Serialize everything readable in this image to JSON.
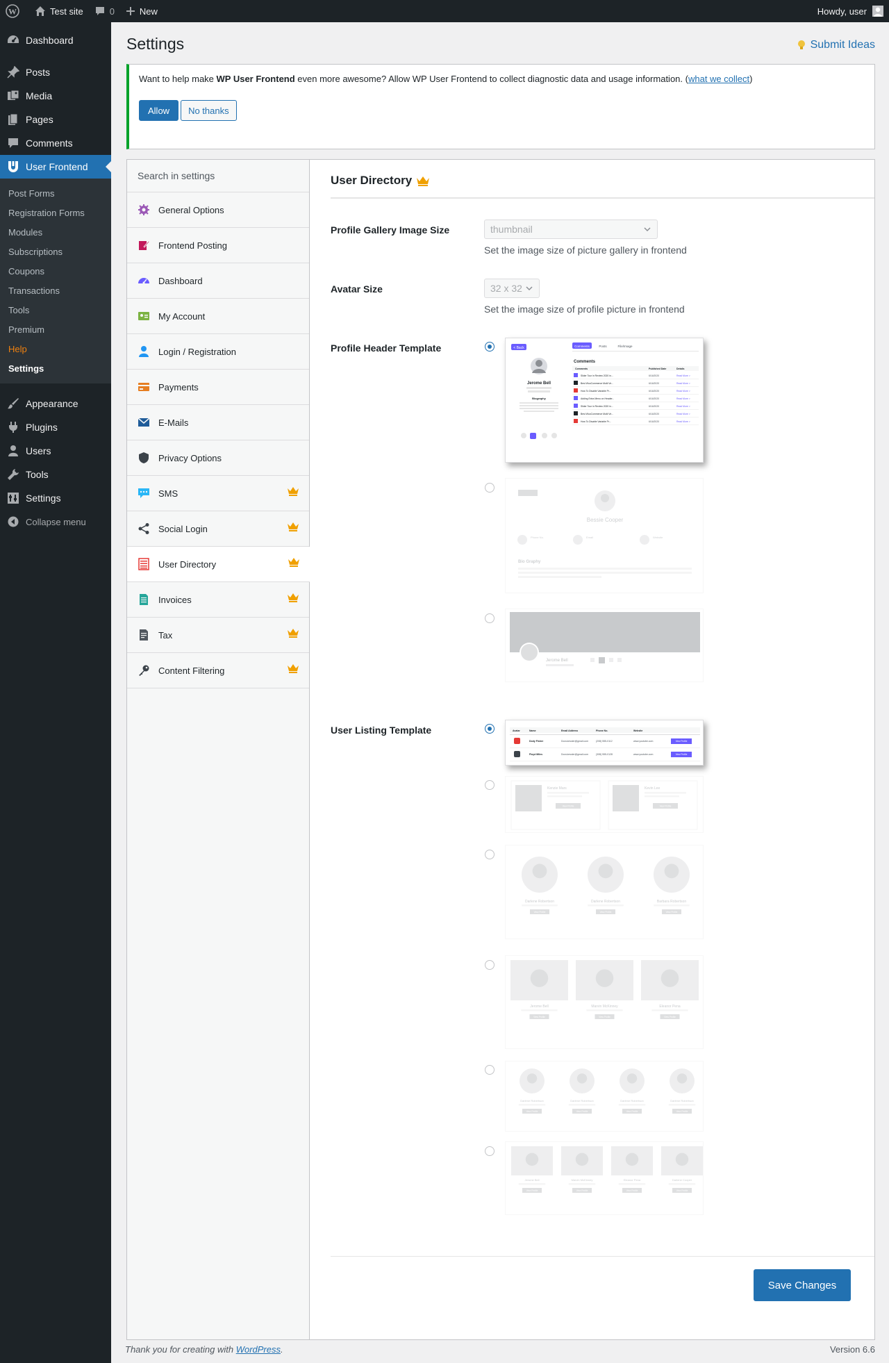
{
  "adminbar": {
    "site_name": "Test site",
    "comments_count": "0",
    "new_label": "New",
    "howdy": "Howdy, user"
  },
  "sidebar": {
    "top_items": [
      {
        "label": "Dashboard",
        "icon": "dashboard-icon"
      },
      {
        "label": "Posts",
        "icon": "pin-icon"
      },
      {
        "label": "Media",
        "icon": "media-icon"
      },
      {
        "label": "Pages",
        "icon": "pages-icon"
      },
      {
        "label": "Comments",
        "icon": "comment-icon"
      },
      {
        "label": "User Frontend",
        "icon": "user-frontend-icon"
      }
    ],
    "submenu": [
      "Post Forms",
      "Registration Forms",
      "Modules",
      "Subscriptions",
      "Coupons",
      "Transactions",
      "Tools",
      "Premium",
      "Help",
      "Settings"
    ],
    "bottom_items": [
      {
        "label": "Appearance",
        "icon": "brush-icon"
      },
      {
        "label": "Plugins",
        "icon": "plugin-icon"
      },
      {
        "label": "Users",
        "icon": "users-icon"
      },
      {
        "label": "Tools",
        "icon": "wrench-icon"
      },
      {
        "label": "Settings",
        "icon": "settings-icon"
      }
    ],
    "collapse_label": "Collapse menu"
  },
  "page": {
    "title": "Settings",
    "submit_ideas": "Submit Ideas"
  },
  "notice": {
    "text_before": "Want to help make ",
    "product": "WP User Frontend",
    "text_after": " even more awesome? Allow WP User Frontend to collect diagnostic data and usage information. (",
    "link": "what we collect",
    "text_end": ")",
    "allow": "Allow",
    "no_thanks": "No thanks"
  },
  "settings_nav": {
    "search_placeholder": "Search in settings",
    "items": [
      {
        "label": "General Options",
        "icon": "gear-icon",
        "pro": false
      },
      {
        "label": "Frontend Posting",
        "icon": "edit-post-icon",
        "pro": false
      },
      {
        "label": "Dashboard",
        "icon": "dashboard-gauge-icon",
        "pro": false
      },
      {
        "label": "My Account",
        "icon": "id-card-icon",
        "pro": false
      },
      {
        "label": "Login / Registration",
        "icon": "user-icon",
        "pro": false
      },
      {
        "label": "Payments",
        "icon": "payment-icon",
        "pro": false
      },
      {
        "label": "E-Mails",
        "icon": "envelope-icon",
        "pro": false
      },
      {
        "label": "Privacy Options",
        "icon": "shield-icon",
        "pro": false
      },
      {
        "label": "SMS",
        "icon": "chat-bubble-icon",
        "pro": true
      },
      {
        "label": "Social Login",
        "icon": "share-icon",
        "pro": true
      },
      {
        "label": "User Directory",
        "icon": "list-icon",
        "pro": true
      },
      {
        "label": "Invoices",
        "icon": "invoice-icon",
        "pro": true
      },
      {
        "label": "Tax",
        "icon": "tax-doc-icon",
        "pro": true
      },
      {
        "label": "Content Filtering",
        "icon": "key-icon",
        "pro": true
      }
    ],
    "active": "User Directory"
  },
  "panel": {
    "title": "User Directory",
    "gallery_label": "Profile Gallery Image Size",
    "gallery_value": "thumbnail",
    "gallery_desc": "Set the image size of picture gallery in frontend",
    "avatar_label": "Avatar Size",
    "avatar_value": "32 x 32",
    "avatar_desc": "Set the image size of profile picture in frontend",
    "profile_header_label": "Profile Header Template",
    "user_listing_label": "User Listing Template",
    "save": "Save Changes"
  },
  "template_text": {
    "layout1_name": "Jerome Bell",
    "layout1_biography": "Biography",
    "layout1_tabs": [
      "Comments",
      "Posts",
      "File/Image"
    ],
    "layout1_table_title": "Comments",
    "layout1_cols": [
      "Comments",
      "Published Date",
      "Details"
    ],
    "layout1_rows": [
      "Slider Tour in Review 2020 in...",
      "Best WooCommerce Multi Ve...",
      "How To Disable Variable Pr...",
      "Adding Extra Menu on Header...",
      "Slider Tour in Review 2020 in...",
      "Best WooCommerce Multi Ve...",
      "How To Disable Variable Pr..."
    ],
    "layout1_date": "6/16/2020",
    "layout1_read": "Read More >",
    "layout1_back": "< Back",
    "layout2_name": "Bessie Cooper",
    "layout2_fields": [
      "Phone No.",
      "Email",
      "Website"
    ],
    "layout2_bio": "Bio Graphy",
    "layout3_name": "Jerome Bell",
    "list_cols": [
      "Avatar",
      "Name",
      "Email Address",
      "Phone No.",
      "Website"
    ],
    "list_rows": [
      {
        "name": "Dody Fisher",
        "email": "Dora.kessler@gmail.com",
        "phone": "(208) 555-0112",
        "site": "www.youtube.com"
      },
      {
        "name": "Floyd Miles",
        "email": "Dora.kessler@gmail.com",
        "phone": "(308) 555-0128",
        "site": "www.youtube.com"
      }
    ],
    "view_profile": "View Profile",
    "list2_names": [
      "Kenzie Mars",
      "Kevin Lee"
    ],
    "list3_names": [
      "Darlene Robertson",
      "Darlene Robertson",
      "Barbara Robertson"
    ],
    "list4_names": [
      "Jerome Bell",
      "Marvin McKinney",
      "Eleanor Pena"
    ],
    "list5_names": [
      "Darlene Robertson",
      "Darlene Robertson",
      "Darlene Robertson",
      "Darlene Robertson"
    ],
    "list6_names": [
      "Jerome Bell",
      "Marvin McKinney",
      "Eleanor Pena",
      "Darlene Cooper"
    ]
  },
  "footer": {
    "thanks_before": "Thank you for creating with ",
    "wordpress": "WordPress",
    "thanks_after": ".",
    "version": "Version 6.6"
  },
  "colors": {
    "accent": "#2271b1",
    "admin_bar": "#1d2327",
    "crown": "#f0a000",
    "notice_border": "#00a32a",
    "template_purple": "#6a5cff"
  }
}
